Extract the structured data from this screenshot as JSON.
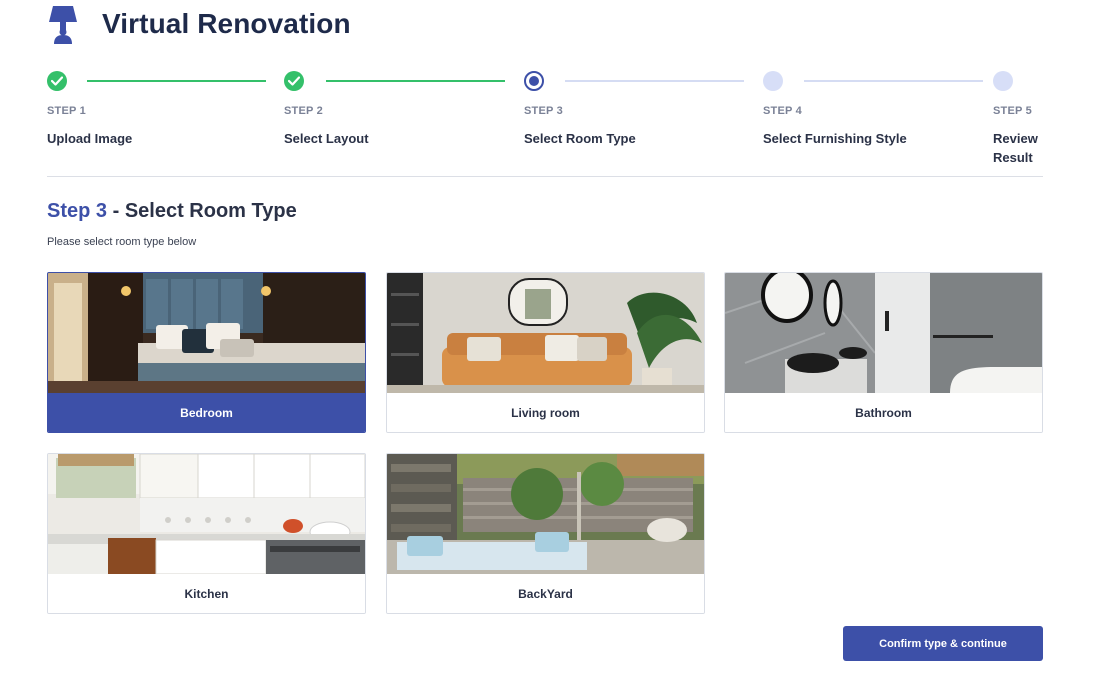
{
  "app": {
    "title": "Virtual Renovation",
    "logo_icon": "lamp-icon"
  },
  "stepper": {
    "steps": [
      {
        "number": "STEP 1",
        "name": "Upload Image",
        "status": "done"
      },
      {
        "number": "STEP 2",
        "name": "Select Layout",
        "status": "done"
      },
      {
        "number": "STEP 3",
        "name": "Select Room Type",
        "status": "current"
      },
      {
        "number": "STEP 4",
        "name": "Select Furnishing Style",
        "status": "todo"
      },
      {
        "number": "STEP 5",
        "name": "Review Result",
        "status": "todo"
      }
    ]
  },
  "section": {
    "step_prefix": "Step 3",
    "separator": " - ",
    "title": "Select Room Type",
    "subtitle": "Please select room type below"
  },
  "room_types": [
    {
      "label": "Bedroom",
      "selected": true
    },
    {
      "label": "Living room",
      "selected": false
    },
    {
      "label": "Bathroom",
      "selected": false
    },
    {
      "label": "Kitchen",
      "selected": false
    },
    {
      "label": "BackYard",
      "selected": false
    }
  ],
  "actions": {
    "confirm_label": "Confirm type & continue"
  },
  "colors": {
    "primary": "#3d50a8",
    "success": "#34c06a",
    "pending": "#d7def7",
    "text_dark": "#1e2a4a",
    "text_muted": "#7a8196"
  }
}
